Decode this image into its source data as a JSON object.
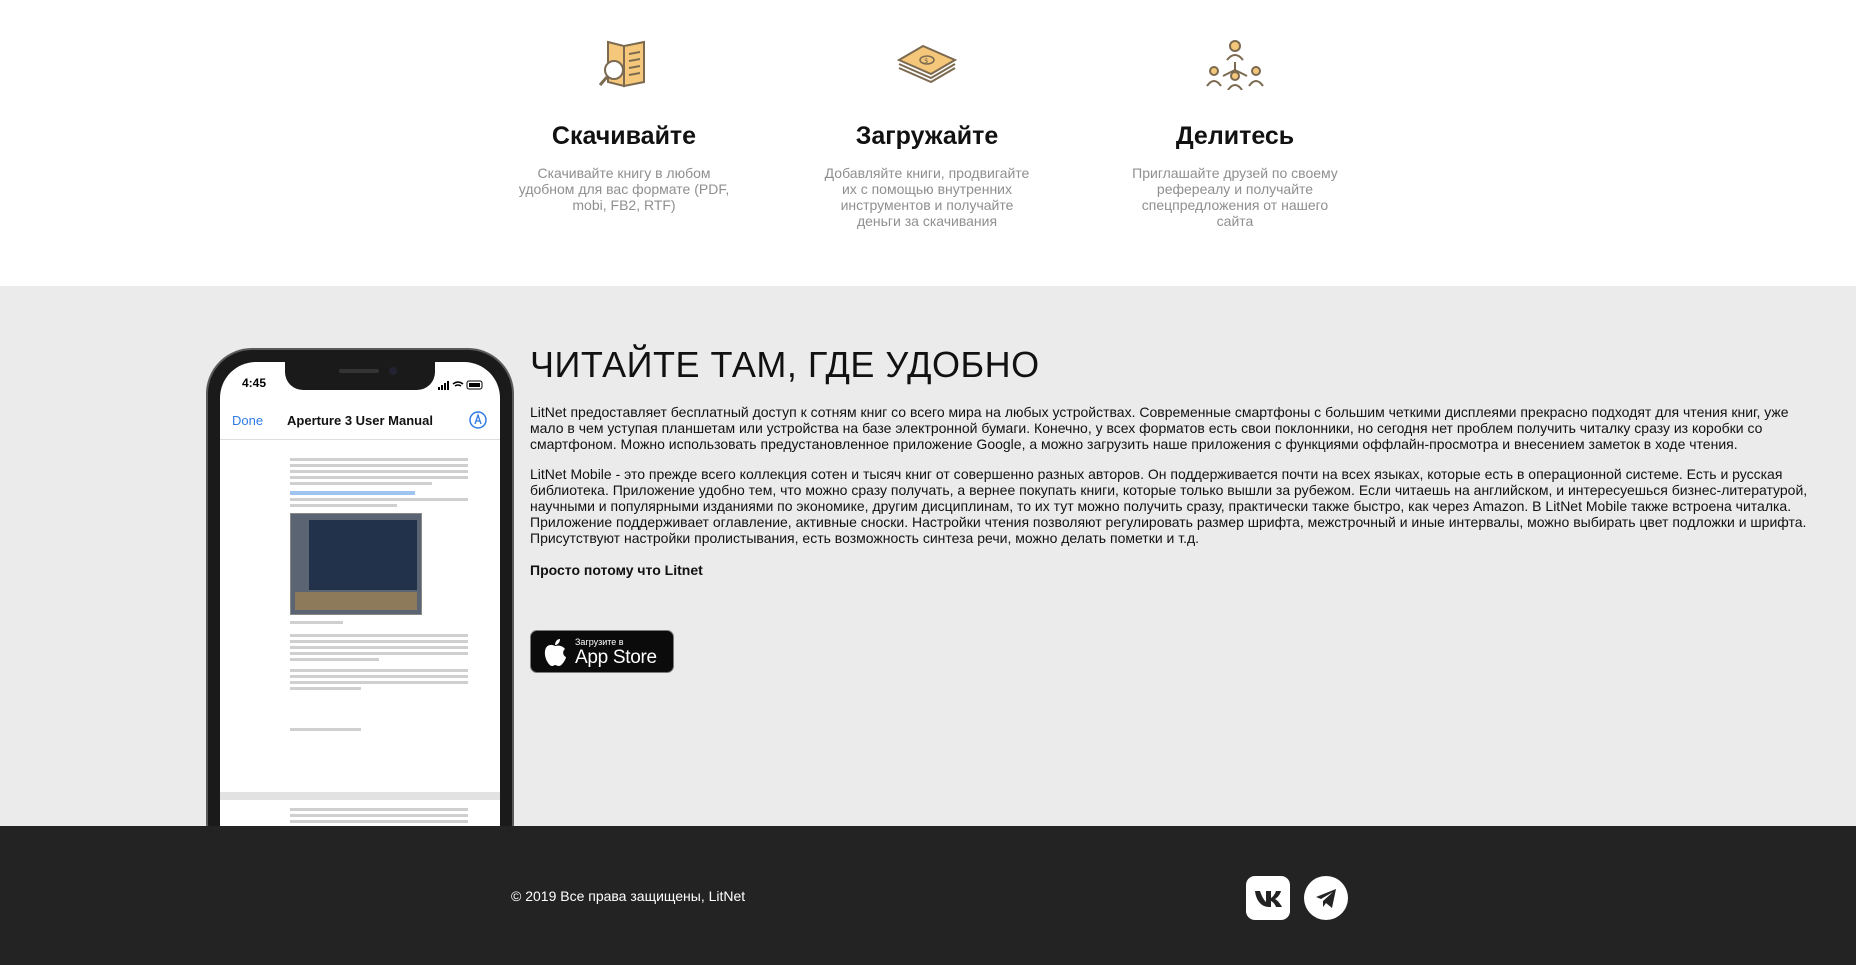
{
  "features": [
    {
      "icon": "book-search-icon",
      "title": "Скачивайте",
      "lines": [
        "Скачивайте книгу в любом",
        "удобном для вас формате (PDF,",
        "mobi, FB2, RTF)"
      ]
    },
    {
      "icon": "money-stack-icon",
      "title": "Загружайте",
      "lines": [
        "Добавляйте книги, продвигайте",
        "их с помощью внутренних",
        "инструментов и получайте",
        "деньги за скачивания"
      ]
    },
    {
      "icon": "referral-network-icon",
      "title": "Делитесь",
      "lines": [
        "Приглашайте друзей по своему",
        "рефереалу и получайте",
        "спецпредложения от нашего",
        "сайта"
      ]
    }
  ],
  "phone": {
    "time": "4:45",
    "done_label": "Done",
    "doc_title": "Aperture 3 User Manual"
  },
  "read": {
    "title": "ЧИТАЙТЕ ТАМ, ГДЕ УДОБНО",
    "paragraph1_lines": [
      "LitNet предоставляет бесплатный доступ к сотням книг со всего мира на любых устройствах. Современные смартфоны с большим четкими дисплеями прекрасно подходят для чтения книг, уже",
      "мало в чем уступая планшетам или устройства на базе электронной бумаги. Конечно, у всех форматов есть свои поклонники, но сегодня нет проблем получить читалку сразу из коробки со",
      "смартфоном. Можно использовать предустановленное приложение Google, а можно загрузить наше приложения с функциями оффлайн-просмотра и внесением заметок в ходе чтения."
    ],
    "paragraph2_lines": [
      "LitNet Mobile - это прежде всего коллекция сотен и тысяч книг от совершенно разных авторов. Он поддерживается почти на всех языках, которые есть в операционной системе. Есть и русская",
      "библиотека. Приложение удобно тем, что можно сразу получать, а вернее покупать книги, которые только вышли за рубежом. Если читаешь на английском, и интересуешься бизнес-литературой,",
      "научными и популярными изданиями по экономике, другим дисциплинам, то их тут можно получить сразу, практически также быстро, как через Amazon. В LitNet Mobile также встроена читалка.",
      "Приложение поддерживает оглавление, активные сноски. Настройки чтения позволяют регулировать размер шрифта, межстрочный и иные интервалы, можно выбирать цвет подложки и шрифта.",
      "Присутствуют настройки пролистывания, есть возможность синтеза речи, можно делать пометки и т.д."
    ],
    "tagline": "Просто потому что Litnet",
    "appstore": {
      "small": "Загрузите в",
      "big": "App Store"
    }
  },
  "footer": {
    "copyright": "© 2019 Все права защищены, LitNet",
    "social": [
      "vk-icon",
      "telegram-icon"
    ]
  },
  "colors": {
    "feature_icon": "#f4c77a",
    "feature_icon_stroke": "#7b6a4f",
    "section_bg": "#ebebeb",
    "footer_bg": "#232323",
    "muted_text": "#8f8f8f",
    "link_blue": "#2f7ae5"
  }
}
